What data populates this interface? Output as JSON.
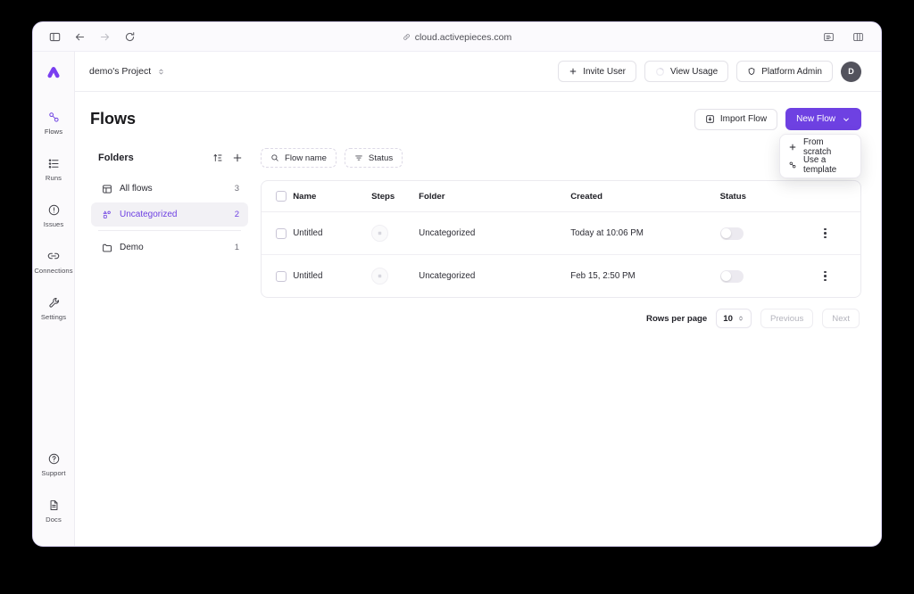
{
  "browser": {
    "url": "cloud.activepieces.com",
    "nav": {
      "sidebar_toggle": "sidebar-toggle",
      "back": "back",
      "forward": "forward",
      "reload": "reload"
    },
    "right_icons": [
      "reader-view",
      "tab-overview"
    ]
  },
  "rail": {
    "logo": "activepieces-logo",
    "items": [
      {
        "label": "Flows",
        "icon": "flows-icon",
        "active": true
      },
      {
        "label": "Runs",
        "icon": "runs-icon",
        "active": false
      },
      {
        "label": "Issues",
        "icon": "issues-icon",
        "active": false
      },
      {
        "label": "Connections",
        "icon": "connections-icon",
        "active": false
      },
      {
        "label": "Settings",
        "icon": "settings-icon",
        "active": false
      }
    ],
    "bottom": [
      {
        "label": "Support",
        "icon": "support-icon"
      },
      {
        "label": "Docs",
        "icon": "docs-icon"
      }
    ]
  },
  "topbar": {
    "project_name": "demo's Project",
    "invite_user": "Invite User",
    "view_usage": "View Usage",
    "platform_admin": "Platform Admin",
    "avatar_initial": "D"
  },
  "page": {
    "title": "Flows",
    "import_flow": "Import Flow",
    "new_flow": "New Flow",
    "dropdown": {
      "open": true,
      "items": [
        {
          "label": "From scratch",
          "icon": "plus-icon"
        },
        {
          "label": "Use a template",
          "icon": "template-icon"
        }
      ]
    }
  },
  "folders": {
    "title": "Folders",
    "actions": [
      "sort-icon",
      "add-folder-icon"
    ],
    "items": [
      {
        "label": "All flows",
        "count": "3",
        "icon": "grid-icon",
        "selected": false
      },
      {
        "label": "Uncategorized",
        "count": "2",
        "icon": "uncategorized-icon",
        "selected": true
      },
      {
        "label": "Demo",
        "count": "1",
        "icon": "folder-icon",
        "selected": false
      }
    ]
  },
  "filters": [
    {
      "label": "Flow name",
      "icon": "search-icon"
    },
    {
      "label": "Status",
      "icon": "filter-icon"
    }
  ],
  "table": {
    "columns": [
      "Name",
      "Steps",
      "Folder",
      "Created",
      "Status"
    ],
    "rows": [
      {
        "name": "Untitled",
        "steps": "",
        "folder": "Uncategorized",
        "created": "Today at 10:06 PM",
        "enabled": false
      },
      {
        "name": "Untitled",
        "steps": "",
        "folder": "Uncategorized",
        "created": "Feb 15, 2:50 PM",
        "enabled": false
      }
    ]
  },
  "pagination": {
    "rows_per_page_label": "Rows per page",
    "rows_per_page_value": "10",
    "previous": "Previous",
    "next": "Next"
  },
  "colors": {
    "accent": "#6e41e2",
    "page_bg": "#ffffff",
    "rail_bg": "#fbfafc",
    "selected_row_bg": "#f2f1f5",
    "window_border": "#d9d2f2"
  }
}
